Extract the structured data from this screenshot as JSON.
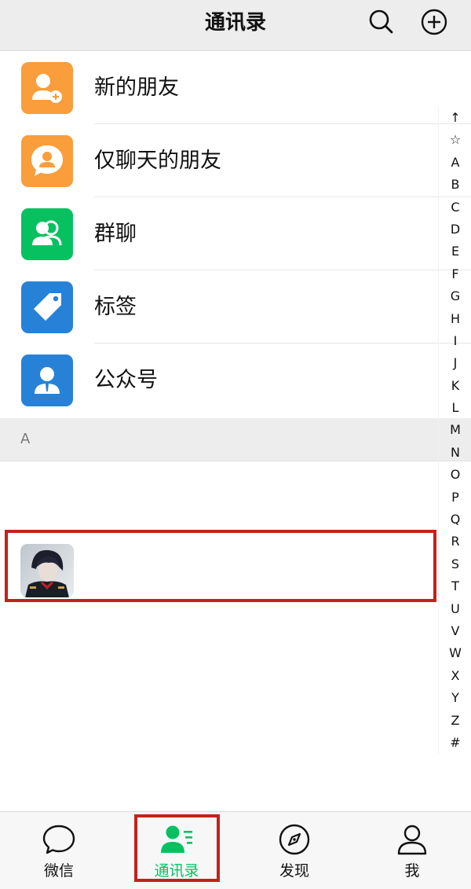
{
  "header": {
    "title": "通讯录",
    "search_icon": "search-icon",
    "add_icon": "add-circle-icon"
  },
  "functions": [
    {
      "label": "新的朋友",
      "icon": "add-friend-icon",
      "color": "#fa9d3b"
    },
    {
      "label": "仅聊天的朋友",
      "icon": "chat-only-friend-icon",
      "color": "#fa9d3b"
    },
    {
      "label": "群聊",
      "icon": "group-chat-icon",
      "color": "#07c160"
    },
    {
      "label": "标签",
      "icon": "tag-icon",
      "color": "#2782d7"
    },
    {
      "label": "公众号",
      "icon": "official-account-icon",
      "color": "#2782d7"
    }
  ],
  "sections": [
    {
      "letter": "A"
    }
  ],
  "contacts": [
    {
      "name": "",
      "avatar": "avatar-image"
    }
  ],
  "alpha_index": [
    "↑",
    "☆",
    "A",
    "B",
    "C",
    "D",
    "E",
    "F",
    "G",
    "H",
    "I",
    "J",
    "K",
    "L",
    "M",
    "N",
    "O",
    "P",
    "Q",
    "R",
    "S",
    "T",
    "U",
    "V",
    "W",
    "X",
    "Y",
    "Z",
    "#"
  ],
  "tabbar": {
    "tabs": [
      {
        "label": "微信",
        "icon": "chat-bubble-icon",
        "active": false
      },
      {
        "label": "通讯录",
        "icon": "contacts-icon",
        "active": true
      },
      {
        "label": "发现",
        "icon": "compass-icon",
        "active": false
      },
      {
        "label": "我",
        "icon": "person-icon",
        "active": false
      }
    ]
  },
  "colors": {
    "accent": "#07c160",
    "highlight": "#c4211b",
    "header_bg": "#ededed"
  }
}
